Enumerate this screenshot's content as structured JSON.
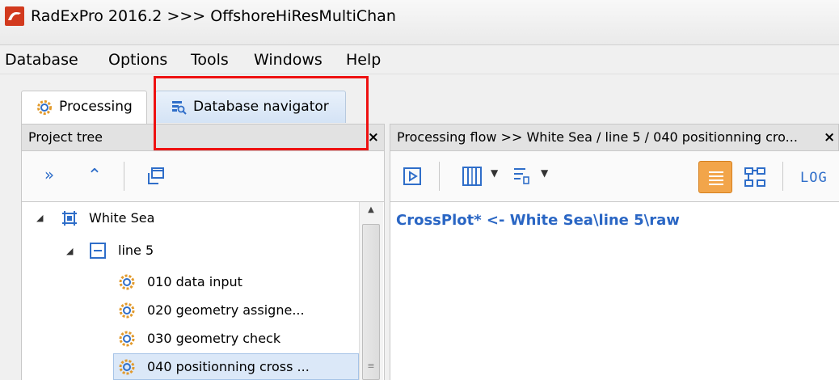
{
  "window": {
    "title": "RadExPro 2016.2 >>> OffshoreHiResMultiChan"
  },
  "menu": [
    "Database",
    "Options",
    "Tools",
    "Windows",
    "Help"
  ],
  "tabs": [
    {
      "label": "Processing",
      "icon": "gear-icon",
      "active": true
    },
    {
      "label": "Database navigator",
      "icon": "database-search-icon",
      "active": false
    }
  ],
  "project_tree": {
    "title": "Project tree",
    "close": "×",
    "toolbar": [
      {
        "glyph": "»",
        "icon": "expand-all-icon"
      },
      {
        "glyph": "⌃",
        "icon": "collapse-all-icon"
      },
      {
        "glyph": "",
        "icon": "copy-windows-icon"
      }
    ],
    "items": [
      {
        "label": "White Sea",
        "icon": "area-icon",
        "level": 0
      },
      {
        "label": "line 5",
        "icon": "line-icon",
        "level": 1
      },
      {
        "label": "010 data input",
        "icon": "flow-gear-icon",
        "level": 2
      },
      {
        "label": "020 geometry assigne...",
        "icon": "flow-gear-icon",
        "level": 2
      },
      {
        "label": "030 geometry check",
        "icon": "flow-gear-icon",
        "level": 2
      },
      {
        "label": "040 positionning cross ...",
        "icon": "flow-gear-icon",
        "level": 2,
        "selected": true
      }
    ]
  },
  "processing_flow": {
    "title": "Processing flow >> White Sea / line 5 / 040 positionning cro...",
    "close": "×",
    "toolbar_log_label": "LOG",
    "content": "CrossPlot* <- White Sea\\line 5\\raw"
  },
  "colors": {
    "highlight": "#ee1111",
    "accent_blue": "#2a66c4",
    "active_button": "#f2a54a"
  }
}
